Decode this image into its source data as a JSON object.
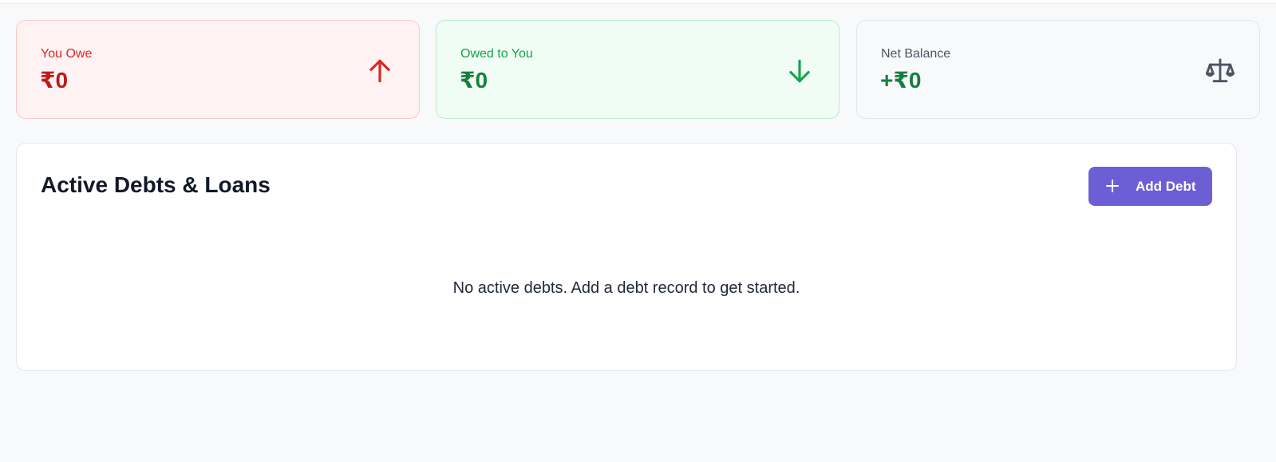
{
  "summary": {
    "you_owe": {
      "label": "You Owe",
      "amount": "₹0",
      "icon": "arrow-up-icon",
      "color": "#dc2626"
    },
    "owed_to_you": {
      "label": "Owed to You",
      "amount": "₹0",
      "icon": "arrow-down-icon",
      "color": "#16a34a"
    },
    "net_balance": {
      "label": "Net Balance",
      "amount": "+₹0",
      "icon": "scale-icon",
      "color": "#4b5563"
    }
  },
  "debts": {
    "title": "Active Debts & Loans",
    "add_button_label": "Add Debt",
    "add_button_icon": "plus-icon",
    "empty_message": "No active debts. Add a debt record to get started.",
    "accent": "#6c5fd6"
  }
}
